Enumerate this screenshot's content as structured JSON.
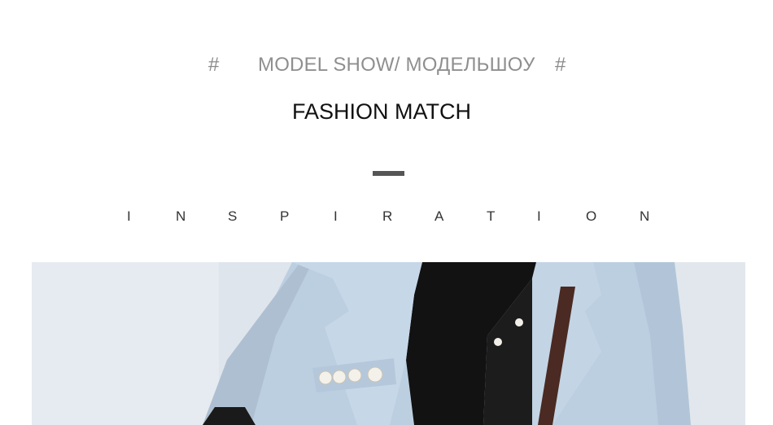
{
  "header": {
    "hash_left": "#",
    "title": "MODEL SHOW/ МОДЕЛЬШОУ",
    "hash_right": "#",
    "subtitle": "FASHION MATCH"
  },
  "inspiration": {
    "letters": [
      "I",
      "N",
      "S",
      "P",
      "I",
      "R",
      "A",
      "T",
      "I",
      "O",
      "N"
    ]
  },
  "photo": {
    "subject": "model-wearing-light-blue-blazer-over-black-blouse",
    "colors": {
      "background": "#dfe5ec",
      "blazer": "#b9cde0",
      "blouse": "#111111",
      "hair": "#7a4a35",
      "strap": "#4a2a22"
    }
  }
}
